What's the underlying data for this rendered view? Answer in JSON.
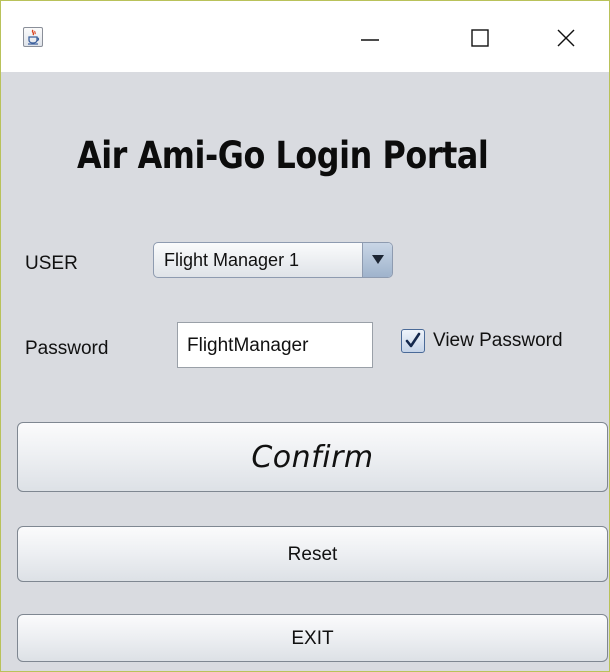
{
  "titlebar": {
    "app_icon": "java-cup-icon",
    "controls": {
      "minimize_icon": "minimize-icon",
      "maximize_icon": "maximize-icon",
      "close_icon": "close-icon"
    }
  },
  "portal": {
    "title": "Air Ami-Go Login Portal"
  },
  "user": {
    "label": "USER",
    "selected": "Flight Manager 1",
    "dropdown_icon": "chevron-down-icon"
  },
  "password": {
    "label": "Password",
    "value": "FlightManager"
  },
  "view_password": {
    "label": "View Password",
    "checked": true
  },
  "buttons": {
    "confirm": "Confirm",
    "reset": "Reset",
    "exit": "EXIT"
  },
  "colors": {
    "window_background": "#d9dbe0",
    "titlebar_background": "#ffffff",
    "window_border": "#b9c25a",
    "checkbox_accent": "#1f3f7a"
  }
}
